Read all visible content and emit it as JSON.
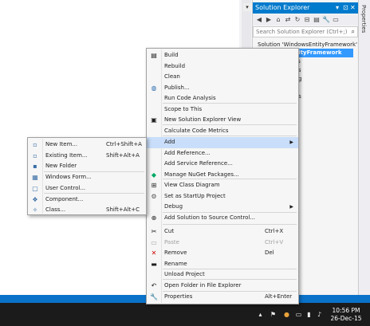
{
  "solution_explorer": {
    "title": "Solution Explorer",
    "title_controls": [
      "▾",
      "⊡",
      "✕"
    ],
    "toolbar_icons": [
      "back-icon",
      "forward-icon",
      "home-icon",
      "sync-icon",
      "refresh-icon",
      "collapse-icon",
      "show-all-icon",
      "properties-icon",
      "preview-icon"
    ],
    "search_placeholder": "Search Solution Explorer (Ctrl+;)",
    "nodes": [
      {
        "label": "Solution 'WindowsEntityFramework'",
        "selected": false
      },
      {
        "label": "sEntityFramework",
        "selected": true
      },
      {
        "label": "erties",
        "selected": false
      },
      {
        "label": "ences",
        "selected": false
      },
      {
        "label": "config",
        "selected": false
      },
      {
        "label": "1.cs",
        "selected": false
      },
      {
        "label": "am.cs",
        "selected": false
      }
    ]
  },
  "properties_tab": "Properties",
  "context_menu": {
    "items": [
      {
        "label": "Build",
        "icon": "build-icon",
        "shortcut": "",
        "sub": false
      },
      {
        "label": "Rebuild",
        "icon": "",
        "shortcut": "",
        "sub": false
      },
      {
        "label": "Clean",
        "icon": "",
        "shortcut": "",
        "sub": false
      },
      {
        "label": "Publish...",
        "icon": "globe-icon",
        "shortcut": "",
        "sub": false
      },
      {
        "label": "Run Code Analysis",
        "icon": "",
        "shortcut": "",
        "sub": false
      },
      {
        "label": "Scope to This",
        "icon": "",
        "shortcut": "",
        "sub": false
      },
      {
        "label": "New Solution Explorer View",
        "icon": "new-view-icon",
        "shortcut": "",
        "sub": false
      },
      {
        "label": "Calculate Code Metrics",
        "icon": "",
        "shortcut": "",
        "sub": false
      },
      {
        "label": "Add",
        "icon": "",
        "shortcut": "",
        "sub": true
      },
      {
        "label": "Add Reference...",
        "icon": "",
        "shortcut": "",
        "sub": false
      },
      {
        "label": "Add Service Reference...",
        "icon": "",
        "shortcut": "",
        "sub": false
      },
      {
        "label": "Manage NuGet Packages...",
        "icon": "nuget-icon",
        "shortcut": "",
        "sub": false
      },
      {
        "label": "View Class Diagram",
        "icon": "class-diagram-icon",
        "shortcut": "",
        "sub": false
      },
      {
        "label": "Set as StartUp Project",
        "icon": "gear-icon",
        "shortcut": "",
        "sub": false
      },
      {
        "label": "Debug",
        "icon": "",
        "shortcut": "",
        "sub": true
      },
      {
        "label": "Add Solution to Source Control...",
        "icon": "source-control-icon",
        "shortcut": "",
        "sub": false
      },
      {
        "label": "Cut",
        "icon": "scissors-icon",
        "shortcut": "Ctrl+X",
        "sub": false
      },
      {
        "label": "Paste",
        "icon": "paste-icon",
        "shortcut": "Ctrl+V",
        "sub": false
      },
      {
        "label": "Remove",
        "icon": "remove-icon",
        "shortcut": "Del",
        "sub": false
      },
      {
        "label": "Rename",
        "icon": "rename-icon",
        "shortcut": "",
        "sub": false
      },
      {
        "label": "Unload Project",
        "icon": "",
        "shortcut": "",
        "sub": false
      },
      {
        "label": "Open Folder in File Explorer",
        "icon": "folder-open-icon",
        "shortcut": "",
        "sub": false
      },
      {
        "label": "Properties",
        "icon": "wrench-icon",
        "shortcut": "Alt+Enter",
        "sub": false
      }
    ]
  },
  "submenu": {
    "items": [
      {
        "label": "New Item...",
        "icon": "new-item-icon",
        "shortcut": "Ctrl+Shift+A"
      },
      {
        "label": "Existing Item...",
        "icon": "existing-item-icon",
        "shortcut": "Shift+Alt+A"
      },
      {
        "label": "New Folder",
        "icon": "new-folder-icon",
        "shortcut": ""
      },
      {
        "label": "Windows Form...",
        "icon": "windows-form-icon",
        "shortcut": ""
      },
      {
        "label": "User Control...",
        "icon": "user-control-icon",
        "shortcut": ""
      },
      {
        "label": "Component...",
        "icon": "component-icon",
        "shortcut": ""
      },
      {
        "label": "Class...",
        "icon": "class-icon",
        "shortcut": "Shift+Alt+C"
      }
    ]
  },
  "taskbar": {
    "time": "10:56 PM",
    "date": "26-Dec-15",
    "tray_icons": [
      "chevron-up-icon",
      "flag-icon",
      "app-icon",
      "display-icon",
      "signal-icon",
      "volume-icon"
    ]
  },
  "colors": {
    "accent": "#007acc",
    "selection": "#3399ff",
    "statusbar": "#0a72c9",
    "menu_hover": "#c9defa"
  }
}
